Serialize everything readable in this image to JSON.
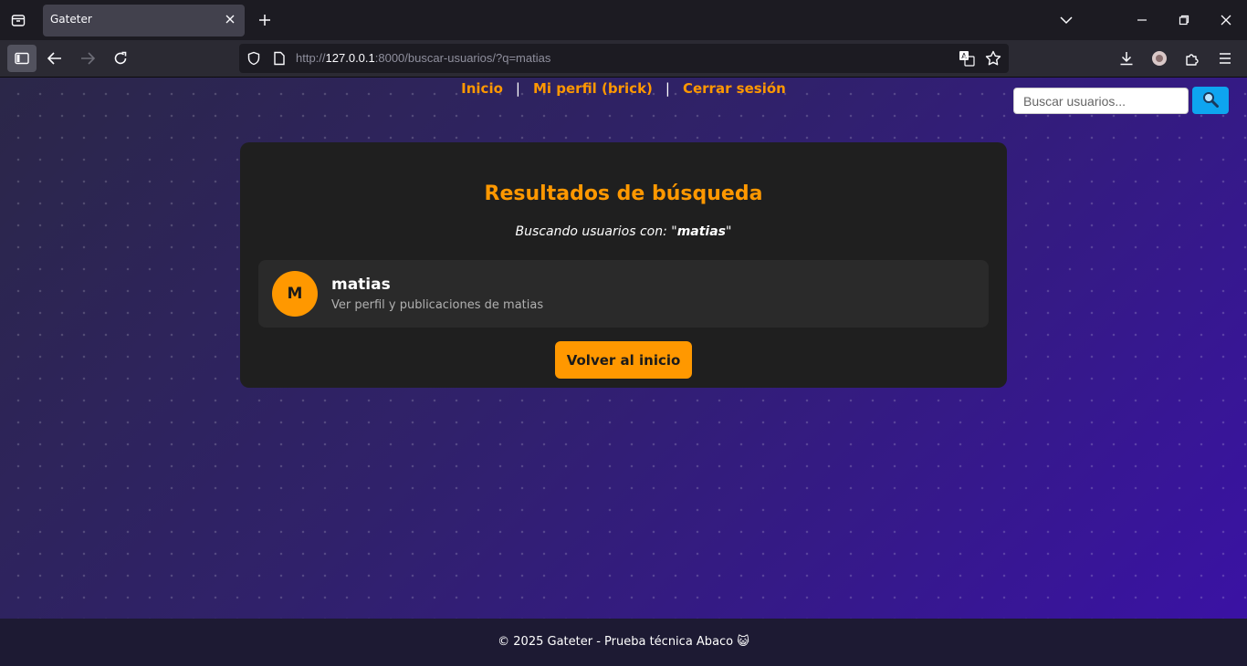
{
  "browser": {
    "tab_title": "Gateter",
    "url_scheme": "http://",
    "url_host": "127.0.0.1",
    "url_rest": ":8000/buscar-usuarios/?q=matias"
  },
  "nav": {
    "home": "Inicio",
    "separator": "|",
    "profile": "Mi perfil (brick)",
    "logout": "Cerrar sesión"
  },
  "search": {
    "placeholder": "Buscar usuarios...",
    "button_icon": "magnifier-icon"
  },
  "card": {
    "title": "Resultados de búsqueda",
    "subtitle_prefix": "Buscando usuarios con: \"",
    "query": "matias",
    "subtitle_suffix": "\"",
    "results": [
      {
        "initial": "M",
        "username": "matias",
        "description": "Ver perfil y publicaciones de matias"
      }
    ],
    "back_button": "Volver al inicio"
  },
  "footer": {
    "text": "© 2025 Gateter - Prueba técnica Abaco 😺"
  },
  "colors": {
    "accent": "#ff9800",
    "search_button": "#0ea5f0",
    "card_bg": "#1f1f1f"
  }
}
